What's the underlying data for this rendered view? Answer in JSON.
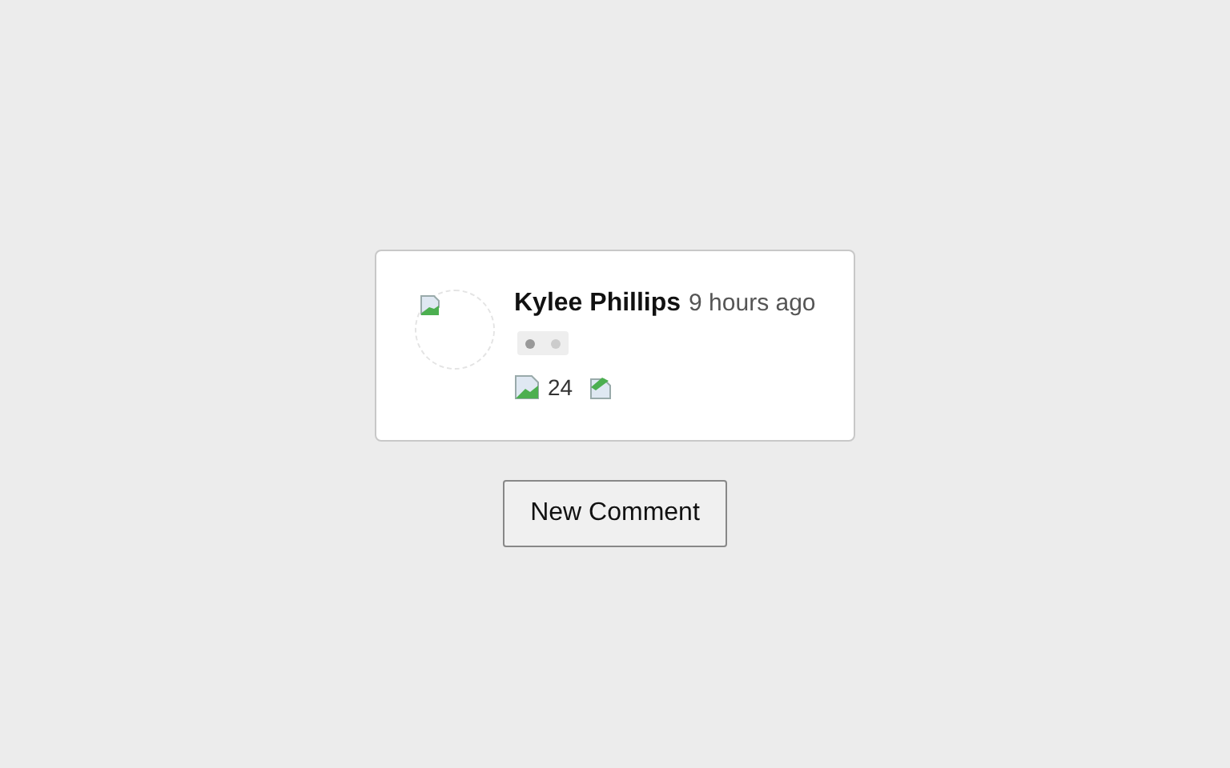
{
  "comment": {
    "author": "Kylee Phillips",
    "time": "9 hours ago",
    "typing": true,
    "likes": "24"
  },
  "button": "New Comment"
}
